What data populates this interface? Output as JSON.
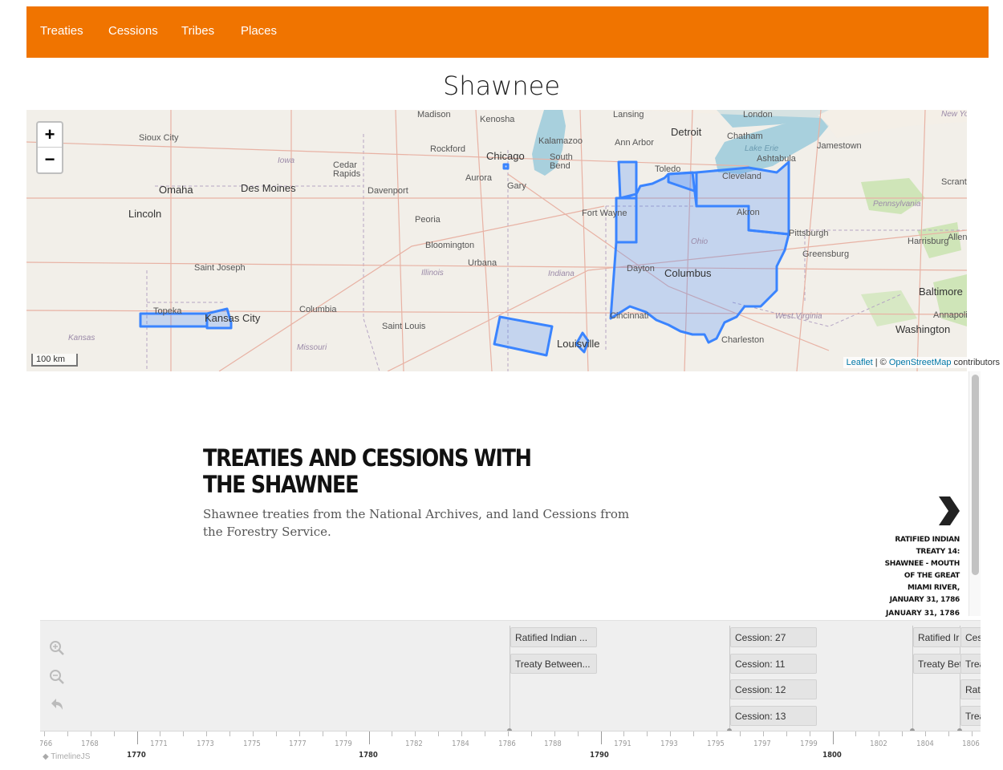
{
  "nav": {
    "items": [
      {
        "label": "Treaties"
      },
      {
        "label": "Cessions"
      },
      {
        "label": "Tribes"
      },
      {
        "label": "Places"
      }
    ],
    "background": "#f07400"
  },
  "page": {
    "title": "Shawnee"
  },
  "map": {
    "zoom_in": "+",
    "zoom_out": "−",
    "scale": "100 km",
    "attribution": {
      "leaflet": "Leaflet",
      "sep": " | © ",
      "osm": "OpenStreetMap",
      "suffix": " contributors"
    },
    "polygon_color": "#3a84ff",
    "labels": {
      "sioux_city": "Sioux City",
      "omaha": "Omaha",
      "lincoln": "Lincoln",
      "des_moines": "Des Moines",
      "iowa": "Iowa",
      "cedar_rapids": "Cedar\nRapids",
      "davenport": "Davenport",
      "kenosha": "Kenosha",
      "rockford": "Rockford",
      "chicago": "Chicago",
      "aurora": "Aurora",
      "gary": "Gary",
      "south_bend": "South\nBend",
      "kalamazoo": "Kalamazoo",
      "ann_arbor": "Ann Arbor",
      "lansing": "Lansing",
      "detroit": "Detroit",
      "chatham": "Chatham",
      "london": "London",
      "toledo": "Toledo",
      "cleveland": "Cleveland",
      "ashtabula": "Ashtabula",
      "lake_erie": "Lake Erie",
      "jamestown": "Jamestown",
      "new_york": "New York",
      "scranton": "Scrant",
      "fort_wayne": "Fort Wayne",
      "akron": "Akron",
      "pittsburgh": "Pittsburgh",
      "pennsylvania": "Pennsylvania",
      "harrisburg": "Harrisburg",
      "allentown": "Allen",
      "greensburg": "Greensburg",
      "ohio": "Ohio",
      "peoria": "Peoria",
      "bloomington": "Bloomington",
      "urbana": "Urbana",
      "illinois": "Illinois",
      "indiana": "Indiana",
      "dayton": "Dayton",
      "columbus": "Columbus",
      "baltimore": "Baltimore",
      "annapolis": "Annapoli",
      "washington": "Washington",
      "saint_joseph": "Saint Joseph",
      "topeka": "Topeka",
      "kansas_city": "Kansas City",
      "kansas": "Kansas",
      "columbia": "Columbia",
      "missouri": "Missouri",
      "saint_louis": "Saint Louis",
      "cincinnati": "Cincinnati",
      "west_virginia": "West Virginia",
      "charleston": "Charleston",
      "louisville": "Louisville",
      "madison": "Madison"
    }
  },
  "story": {
    "headline": "TREATIES AND CESSIONS WITH THE SHAWNEE",
    "text": "Shawnee treaties from the National Archives, and land Cessions from the Forestry Service.",
    "next": {
      "title": "RATIFIED INDIAN TREATY 14: SHAWNEE - MOUTH OF THE GREAT MIAMI RIVER, JANUARY 31, 1786",
      "date": "JANUARY 31, 1786"
    }
  },
  "timenav": {
    "markers": [
      {
        "label": "Ratified Indian ..."
      },
      {
        "label": "Treaty Between..."
      },
      {
        "label": "Cession: 27"
      },
      {
        "label": "Cession: 11"
      },
      {
        "label": "Cession: 12"
      },
      {
        "label": "Cession: 13"
      },
      {
        "label": "Ratified Ir"
      },
      {
        "label": "Treaty Bet"
      },
      {
        "label": "Ces"
      },
      {
        "label": "Trea"
      },
      {
        "label": "Rat"
      },
      {
        "label": "Trea"
      }
    ],
    "minor_ticks": [
      "766",
      "1768",
      "1771",
      "1773",
      "1775",
      "1777",
      "1779",
      "1782",
      "1784",
      "1786",
      "1788",
      "1791",
      "1793",
      "1795",
      "1797",
      "1799",
      "1802",
      "1804",
      "1806"
    ],
    "major_ticks": [
      "1770",
      "1780",
      "1790",
      "1800"
    ],
    "brand": "TimelineJS"
  }
}
